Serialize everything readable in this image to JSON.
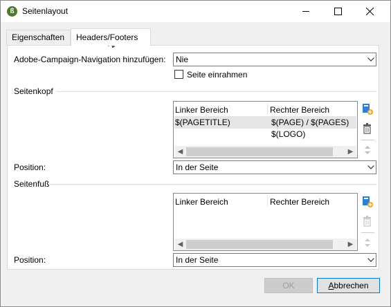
{
  "window": {
    "title": "Seitenlayout",
    "app_icon_glyph": "ß",
    "accent": "#0078d7"
  },
  "tabs": [
    {
      "label": "Eigenschaften",
      "active": false
    },
    {
      "label": "Headers/Footers",
      "active": true
    }
  ],
  "navigation": {
    "label": "Adobe-Campaign-Navigation hinzufügen:",
    "value": "Nie"
  },
  "frame_page": {
    "label": "Seite einrahmen",
    "checked": false
  },
  "header_section": {
    "title": "Seitenkopf",
    "columns": [
      "Linker Bereich",
      "Rechter Bereich"
    ],
    "rows": [
      {
        "left": "$(PAGETITLE)",
        "right": "$(PAGE) / $(PAGES)"
      },
      {
        "left": "",
        "right": "$(LOGO)"
      }
    ],
    "position_label": "Position:",
    "position_value": "In der Seite"
  },
  "footer_section": {
    "title": "Seitenfuß",
    "columns": [
      "Linker Bereich",
      "Rechter Bereich"
    ],
    "rows": [],
    "position_label": "Position:",
    "position_value": "In der Seite"
  },
  "buttons": {
    "ok": "OK",
    "cancel_first": "A",
    "cancel_rest": "bbrechen"
  }
}
